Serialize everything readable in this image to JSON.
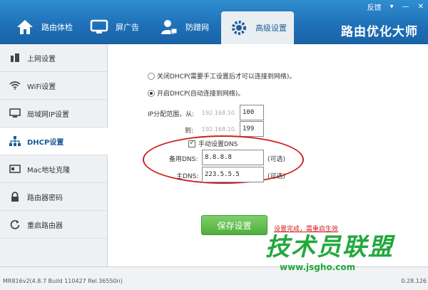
{
  "window": {
    "controls": {
      "feedback": "反馈",
      "menu": "▾",
      "minimize": "—",
      "close": "✕"
    }
  },
  "tabs": [
    {
      "label": "路由体检"
    },
    {
      "label": "屏广告"
    },
    {
      "label": "防蹭网"
    },
    {
      "label": "高级设置",
      "active": true
    }
  ],
  "brand": "路由优化大师",
  "sidebar": {
    "items": [
      {
        "label": "上网设置"
      },
      {
        "label": "WiFi设置"
      },
      {
        "label": "局域网IP设置"
      },
      {
        "label": "DHCP设置",
        "active": true
      },
      {
        "label": "Mac地址克隆"
      },
      {
        "label": "路由器密码"
      },
      {
        "label": "重启路由器"
      }
    ]
  },
  "dhcp": {
    "disable_label": "关闭DHCP(需要手工设置后才可以连接到网络)。",
    "enable_label": "开启DHCP(自动连接到网络)。",
    "selected": "enable",
    "range_from_label": "IP分配范围，从:",
    "range_to_label": "到:",
    "ip_prefix": "192.168.10.",
    "range_from_value": "100",
    "range_to_value": "199",
    "manual_dns_label": "手动设置DNS",
    "manual_dns_checked": true,
    "backup_dns_label": "备用DNS:",
    "backup_dns_value": "8.8.8.8",
    "primary_dns_label": "主DNS:",
    "primary_dns_value": "223.5.5.5",
    "optional_label": "(可选)"
  },
  "actions": {
    "save_label": "保存设置",
    "status_text": "设置完成，需重启生效"
  },
  "footer": {
    "version": "MR816v2(4.8.7 Build 110427 Rel.36550n)",
    "ip_tail": "0.28.126"
  },
  "watermark": {
    "text": "技术员联盟",
    "url": "www.jsgho.com"
  },
  "colors": {
    "accent": "#1f6fb6",
    "save_green": "#4fae3c",
    "alert_red": "#d21c1c"
  }
}
